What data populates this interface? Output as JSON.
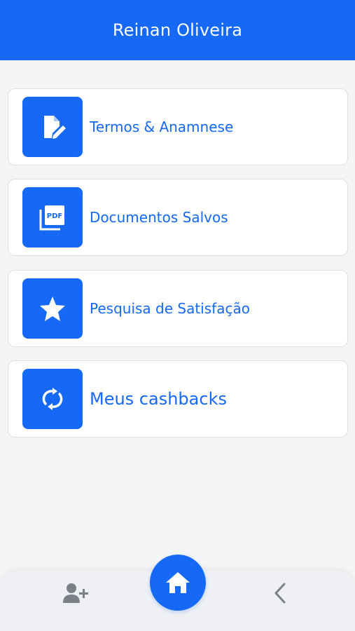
{
  "header": {
    "title": "Reinan Oliveira"
  },
  "menu": {
    "items": [
      {
        "label": "Termos & Anamnese",
        "icon": "edit-document-icon"
      },
      {
        "label": "Documentos Salvos",
        "icon": "pdf-files-icon"
      },
      {
        "label": "Pesquisa de Satisfação",
        "icon": "star-icon"
      },
      {
        "label": "Meus cashbacks",
        "icon": "refresh-cycle-icon"
      }
    ]
  },
  "bottom_nav": {
    "left_icon": "add-user-icon",
    "center_icon": "home-icon",
    "right_icon": "chevron-left-icon"
  },
  "colors": {
    "primary": "#1668f6",
    "background": "#f4f5f7",
    "card": "#ffffff",
    "nav_icon": "#7b7f87"
  }
}
